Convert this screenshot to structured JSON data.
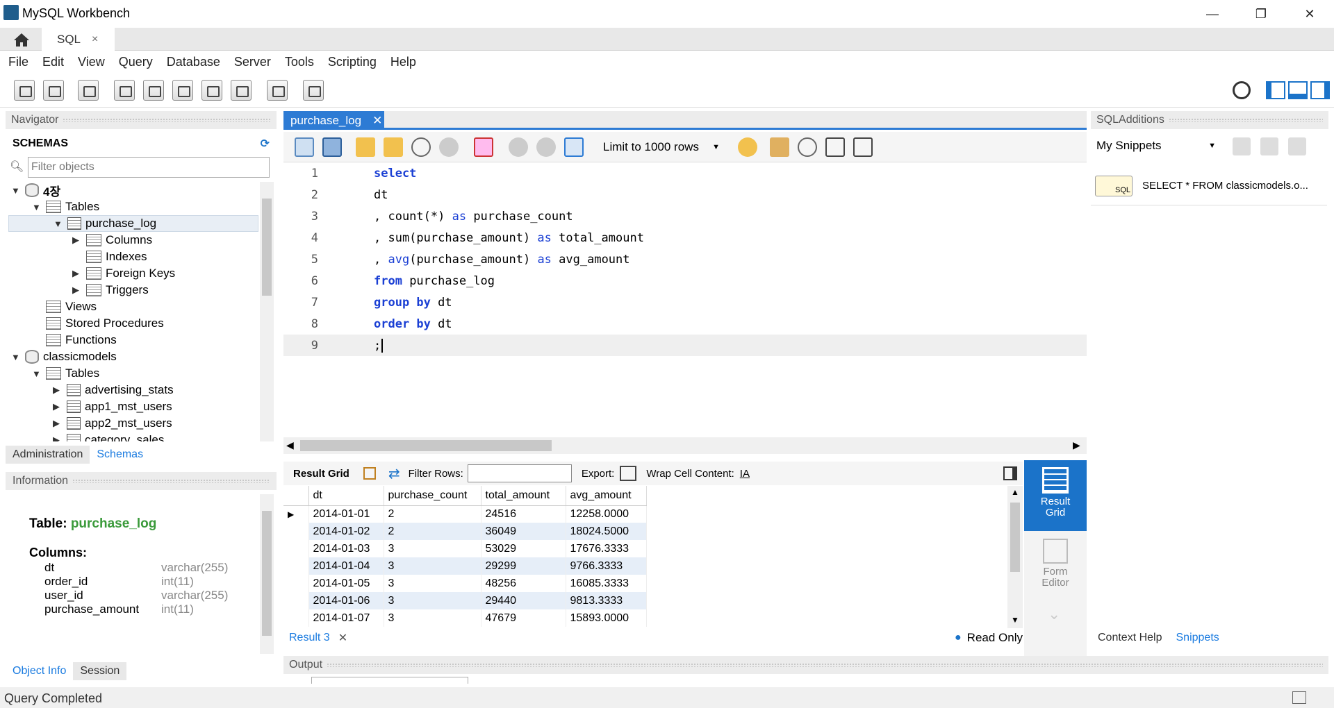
{
  "window": {
    "title": "MySQL Workbench",
    "minimize": "—",
    "restore": "❐",
    "close": "✕"
  },
  "tabs": {
    "home_icon": "home-icon",
    "sql_tab": "SQL",
    "close": "×"
  },
  "menu": [
    "File",
    "Edit",
    "View",
    "Query",
    "Database",
    "Server",
    "Tools",
    "Scripting",
    "Help"
  ],
  "navigator": {
    "title": "Navigator",
    "schemas_label": "SCHEMAS",
    "filter_placeholder": "Filter objects",
    "tree": [
      {
        "label": "4장",
        "bold": true
      },
      {
        "label": "Tables"
      },
      {
        "label": "purchase_log"
      },
      {
        "label": "Columns"
      },
      {
        "label": "Indexes"
      },
      {
        "label": "Foreign Keys"
      },
      {
        "label": "Triggers"
      },
      {
        "label": "Views"
      },
      {
        "label": "Stored Procedures"
      },
      {
        "label": "Functions"
      },
      {
        "label": "classicmodels"
      },
      {
        "label": "Tables"
      },
      {
        "label": "advertising_stats"
      },
      {
        "label": "app1_mst_users"
      },
      {
        "label": "app2_mst_users"
      },
      {
        "label": "category_sales"
      }
    ],
    "bottom_tabs": [
      "Administration",
      "Schemas"
    ]
  },
  "information": {
    "title": "Information",
    "table_label": "Table:",
    "table_name": "purchase_log",
    "columns_label": "Columns:",
    "columns": [
      {
        "name": "dt",
        "type": "varchar(255)"
      },
      {
        "name": "order_id",
        "type": "int(11)"
      },
      {
        "name": "user_id",
        "type": "varchar(255)"
      },
      {
        "name": "purchase_amount",
        "type": "int(11)"
      }
    ],
    "bottom_tabs": [
      "Object Info",
      "Session"
    ]
  },
  "editor": {
    "tab": "purchase_log",
    "tab_close": "✕",
    "limit": "Limit to 1000 rows",
    "lines": [
      "1",
      "2",
      "3",
      "4",
      "5",
      "6",
      "7",
      "8",
      "9"
    ]
  },
  "results": {
    "result_grid": "Result Grid",
    "filter_rows": "Filter Rows:",
    "export": "Export:",
    "wrap": "Wrap Cell Content:",
    "columns": [
      "dt",
      "purchase_count",
      "total_amount",
      "avg_amount"
    ],
    "rows": [
      [
        "2014-01-01",
        "2",
        "24516",
        "12258.0000"
      ],
      [
        "2014-01-02",
        "2",
        "36049",
        "18024.5000"
      ],
      [
        "2014-01-03",
        "3",
        "53029",
        "17676.3333"
      ],
      [
        "2014-01-04",
        "3",
        "29299",
        "9766.3333"
      ],
      [
        "2014-01-05",
        "3",
        "48256",
        "16085.3333"
      ],
      [
        "2014-01-06",
        "3",
        "29440",
        "9813.3333"
      ],
      [
        "2014-01-07",
        "3",
        "47679",
        "15893.0000"
      ]
    ],
    "result_tab": "Result 3",
    "result_tab_close": "✕",
    "read_only": "Read Only",
    "side_result_grid": "Result Grid",
    "side_form_editor": "Form Editor"
  },
  "sql_additions": {
    "title": "SQLAdditions",
    "snippets_select": "My Snippets",
    "snippet_text": "SELECT * FROM classicmodels.o...",
    "bottom_tabs": [
      "Context Help",
      "Snippets"
    ]
  },
  "output": {
    "title": "Output"
  },
  "status": {
    "text": "Query Completed"
  }
}
